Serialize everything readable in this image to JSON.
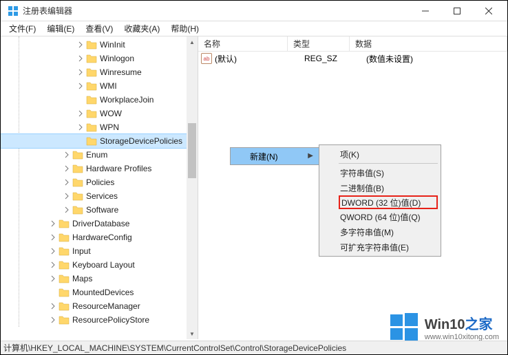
{
  "app": {
    "title": "注册表编辑器"
  },
  "menu": {
    "file": "文件(F)",
    "edit": "编辑(E)",
    "view": "查看(V)",
    "favorites": "收藏夹(A)",
    "help": "帮助(H)"
  },
  "tree": {
    "items": [
      {
        "label": "WinInit",
        "indent": 110,
        "expander": "right"
      },
      {
        "label": "Winlogon",
        "indent": 110,
        "expander": "right"
      },
      {
        "label": "Winresume",
        "indent": 110,
        "expander": "right"
      },
      {
        "label": "WMI",
        "indent": 110,
        "expander": "right"
      },
      {
        "label": "WorkplaceJoin",
        "indent": 110,
        "expander": ""
      },
      {
        "label": "WOW",
        "indent": 110,
        "expander": "right"
      },
      {
        "label": "WPN",
        "indent": 110,
        "expander": "right"
      },
      {
        "label": "StorageDevicePolicies",
        "indent": 110,
        "expander": "",
        "selected": true
      },
      {
        "label": "Enum",
        "indent": 90,
        "expander": "right"
      },
      {
        "label": "Hardware Profiles",
        "indent": 90,
        "expander": "right"
      },
      {
        "label": "Policies",
        "indent": 90,
        "expander": "right"
      },
      {
        "label": "Services",
        "indent": 90,
        "expander": "right"
      },
      {
        "label": "Software",
        "indent": 90,
        "expander": "right"
      },
      {
        "label": "DriverDatabase",
        "indent": 70,
        "expander": "right"
      },
      {
        "label": "HardwareConfig",
        "indent": 70,
        "expander": "right"
      },
      {
        "label": "Input",
        "indent": 70,
        "expander": "right"
      },
      {
        "label": "Keyboard Layout",
        "indent": 70,
        "expander": "right"
      },
      {
        "label": "Maps",
        "indent": 70,
        "expander": "right"
      },
      {
        "label": "MountedDevices",
        "indent": 70,
        "expander": ""
      },
      {
        "label": "ResourceManager",
        "indent": 70,
        "expander": "right"
      },
      {
        "label": "ResourcePolicyStore",
        "indent": 70,
        "expander": "right"
      }
    ]
  },
  "list": {
    "header": {
      "name": "名称",
      "type": "类型",
      "data": "数据"
    },
    "rows": [
      {
        "icon": "ab",
        "name": "(默认)",
        "type": "REG_SZ",
        "data": "(数值未设置)"
      }
    ]
  },
  "context": {
    "new": "新建(N)"
  },
  "submenu": {
    "key": "项(K)",
    "string": "字符串值(S)",
    "binary": "二进制值(B)",
    "dword": "DWORD (32 位)值(D)",
    "qword": "QWORD (64 位)值(Q)",
    "multi": "多字符串值(M)",
    "expand": "可扩充字符串值(E)"
  },
  "status": {
    "path": "计算机\\HKEY_LOCAL_MACHINE\\SYSTEM\\CurrentControlSet\\Control\\StorageDevicePolicies"
  },
  "watermark": {
    "line1a": "Win10",
    "line1b": "之家",
    "line2": "www.win10xitong.com"
  }
}
